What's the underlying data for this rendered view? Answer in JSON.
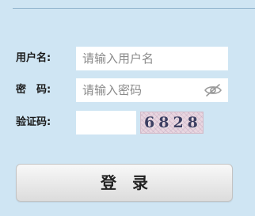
{
  "form": {
    "username": {
      "label": "用户名:",
      "placeholder": "请输入用户名",
      "value": ""
    },
    "password": {
      "label": "密　码:",
      "placeholder": "请输入密码",
      "value": "",
      "toggle_icon": "eye-slash-icon"
    },
    "captcha": {
      "label": "验证码:",
      "value": "",
      "image_text": "6828"
    },
    "login_button_label": "登　录"
  },
  "colors": {
    "background": "#cfe5f3",
    "field_background": "#ffffff",
    "button_background": "#e8e8e8",
    "divider": "#8fb3cc"
  }
}
